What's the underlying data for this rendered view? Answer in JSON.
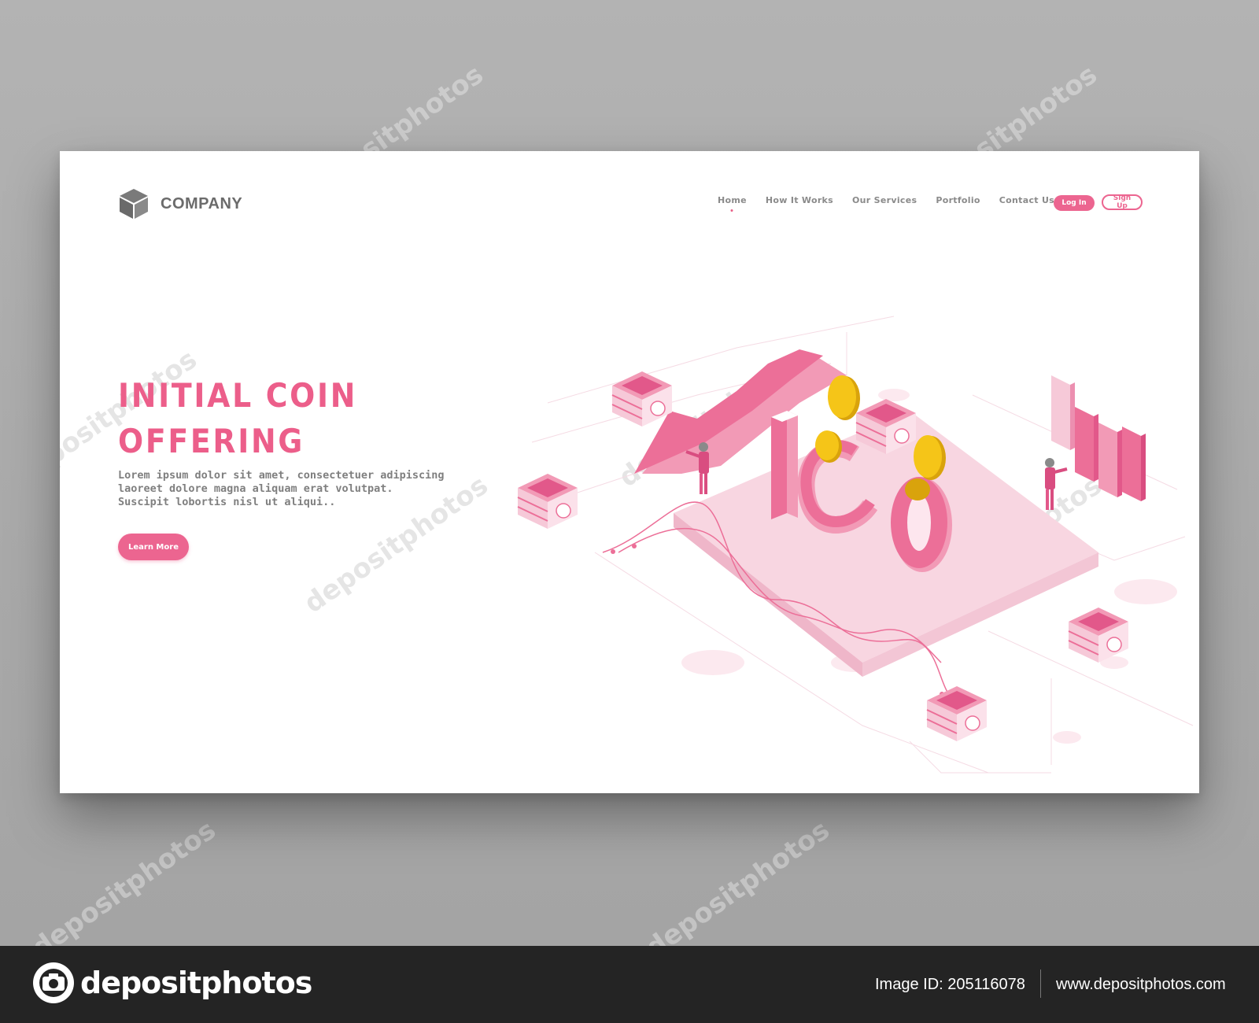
{
  "header": {
    "company_name": "COMPANY",
    "logo_icon": "cube-icon"
  },
  "nav": {
    "items": [
      {
        "label": "Home",
        "active": true
      },
      {
        "label": "How It Works",
        "active": false
      },
      {
        "label": "Our Services",
        "active": false
      },
      {
        "label": "Portfolio",
        "active": false
      },
      {
        "label": "Contact Us",
        "active": false
      }
    ],
    "login_label": "Log In",
    "signup_label": "Sign Up"
  },
  "hero": {
    "title_line1": "INITIAL COIN",
    "title_line2": "OFFERING",
    "desc_line1": "Lorem ipsum dolor sit amet, consectetuer adipiscing",
    "desc_line2": "laoreet dolore magna aliquam erat volutpat.",
    "desc_line3": "Suscipit lobortis nisl ut aliqui..",
    "cta_label": "Learn More"
  },
  "illustration": {
    "letters": "ICO",
    "colors": {
      "accent": "#ec5e8a",
      "pink_light": "#f6c9d8",
      "pink_mid": "#f29ab6",
      "coin": "#f5c518"
    }
  },
  "watermark": {
    "brand": "depositphotos",
    "image_id_label": "Image ID: 205116078",
    "site": "www.depositphotos.com"
  }
}
